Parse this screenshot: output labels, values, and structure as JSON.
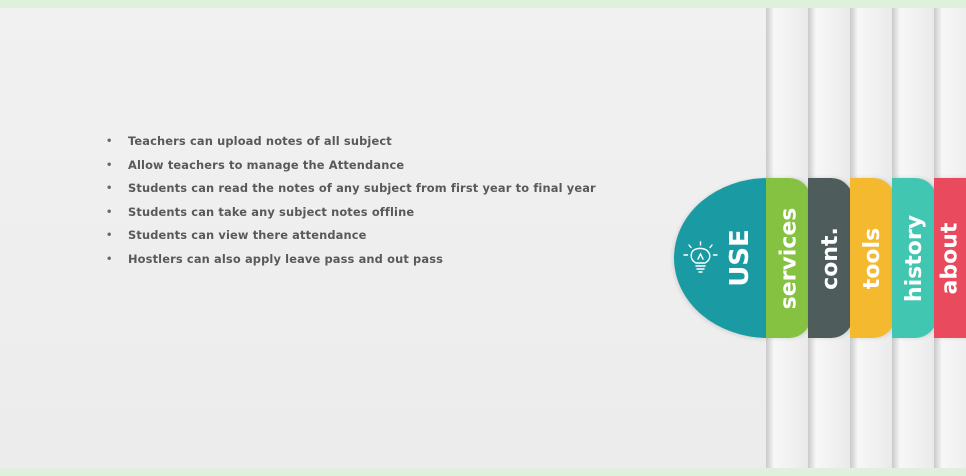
{
  "bullets": [
    "Teachers can upload notes of all subject",
    "Allow teachers to manage the Attendance",
    "Students can read the notes of any subject from first year to final year",
    "Students can take any subject notes offline",
    "Students can view  there attendance",
    "Hostlers can also apply leave pass and out pass"
  ],
  "tabs": {
    "use": "USE",
    "services": "services",
    "contact": "cont.",
    "tools": "tools",
    "history": "history",
    "about": "about"
  },
  "colors": {
    "use": "#1a9ba3",
    "services": "#86c241",
    "contact": "#4f5c5c",
    "tools": "#f4b92e",
    "history": "#41c6b2",
    "about": "#ea4a5e"
  },
  "icons": {
    "use": "lightbulb-icon"
  }
}
